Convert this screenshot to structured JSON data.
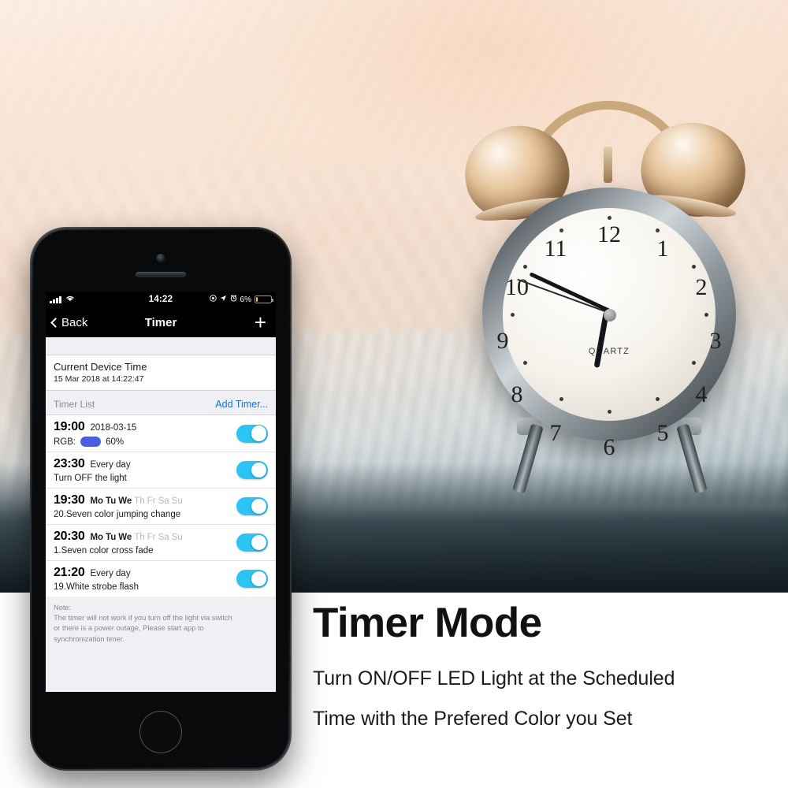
{
  "phone": {
    "status_bar": {
      "signal_icon": "signal-bars-icon",
      "wifi_icon": "wifi-icon",
      "time": "14:22",
      "dnd_icon": "do-not-disturb-icon",
      "location_icon": "location-arrow-icon",
      "alarm_icon": "alarm-clock-icon",
      "battery_percent": "6%",
      "battery_icon": "battery-low-icon",
      "battery_fill_color": "#f5c518"
    },
    "nav": {
      "back_label": "Back",
      "back_icon": "chevron-left-icon",
      "title": "Timer",
      "add_icon": "plus-icon",
      "add_label": "+"
    },
    "device_time": {
      "title": "Current Device Time",
      "value": "15 Mar 2018 at 14:22:47"
    },
    "list_header": {
      "label": "Timer List",
      "add_link": "Add Timer...",
      "link_color": "#1873e8"
    },
    "timers": [
      {
        "time": "19:00",
        "meta": "2018-03-15",
        "meta_type": "date",
        "desc_prefix": "RGB:",
        "swatch_color": "#4a5fe0",
        "desc_suffix": "60%",
        "desc": "",
        "enabled": true,
        "toggle_state": "on"
      },
      {
        "time": "23:30",
        "meta": "Every day",
        "meta_type": "text",
        "desc": "Turn OFF the light",
        "enabled": true,
        "toggle_state": "on"
      },
      {
        "time": "19:30",
        "meta_type": "days",
        "days": [
          {
            "label": "Mo",
            "active": true
          },
          {
            "label": "Tu",
            "active": true
          },
          {
            "label": "We",
            "active": true
          },
          {
            "label": "Th",
            "active": false
          },
          {
            "label": "Fr",
            "active": false
          },
          {
            "label": "Sa",
            "active": false
          },
          {
            "label": "Su",
            "active": false
          }
        ],
        "desc": "20.Seven color jumping change",
        "enabled": true,
        "toggle_state": "on"
      },
      {
        "time": "20:30",
        "meta_type": "days",
        "days": [
          {
            "label": "Mo",
            "active": true
          },
          {
            "label": "Tu",
            "active": true
          },
          {
            "label": "We",
            "active": true
          },
          {
            "label": "Th",
            "active": false
          },
          {
            "label": "Fr",
            "active": false
          },
          {
            "label": "Sa",
            "active": false
          },
          {
            "label": "Su",
            "active": false
          }
        ],
        "desc": "1.Seven color cross fade",
        "enabled": true,
        "toggle_state": "on"
      },
      {
        "time": "21:20",
        "meta": "Every day",
        "meta_type": "text",
        "desc": "19.White strobe flash",
        "enabled": true,
        "toggle_state": "on"
      }
    ],
    "note": {
      "line1": "Note:",
      "line2": "The timer will not work if you turn off the light via switch",
      "line3": "or there is a power outage, Please start app to",
      "line4": "synchronization timer."
    },
    "toggle_on_color": "#2bc4f3",
    "home_button": "home-button"
  },
  "marketing": {
    "headline": "Timer Mode",
    "sub_line_1": "Turn ON/OFF LED Light at the Scheduled",
    "sub_line_2": "Time with the Prefered Color you Set"
  },
  "photo": {
    "subject": "alarm-clock-photo",
    "clock_brand_text": "QUARTZ"
  }
}
